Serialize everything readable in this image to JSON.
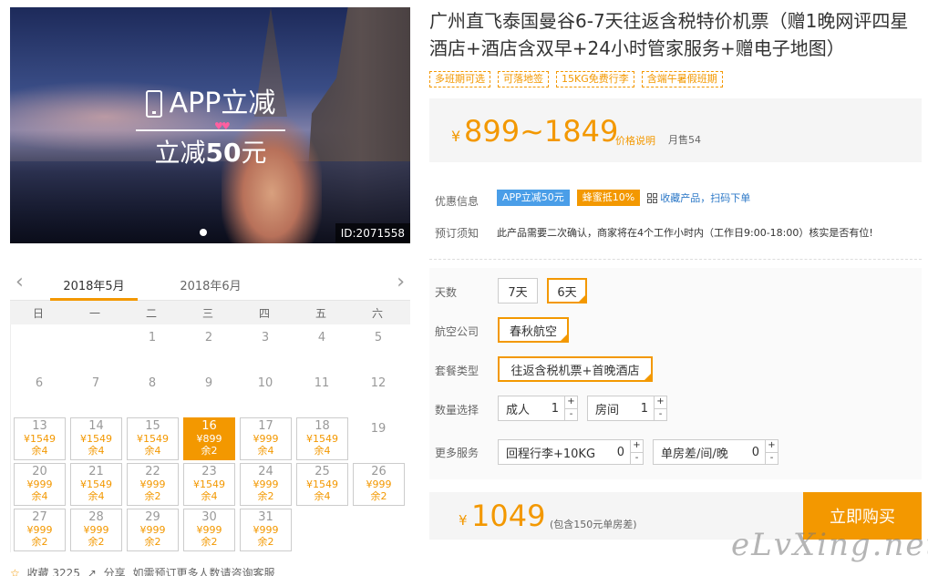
{
  "hero": {
    "promo_top": "APP立减",
    "promo_bottom_prefix": "立减",
    "promo_bottom_amount": "50",
    "promo_bottom_suffix": "元",
    "hearts": "♥♥",
    "id_label": "ID:2071558"
  },
  "calendar": {
    "prev_icon": "‹",
    "next_icon": "›",
    "active_month": "2018年5月",
    "other_month": "2018年6月",
    "weekdays": [
      "日",
      "一",
      "二",
      "三",
      "四",
      "五",
      "六"
    ]
  },
  "footer": {
    "fav_icon": "☆",
    "fav_text": "收藏 3225",
    "share_icon": "↗",
    "share_text": "分享",
    "consult_text": "如需预订更多人数请咨询客服"
  },
  "product": {
    "title": "广州直飞泰国曼谷6-7天往返含税特价机票（赠1晚网评四星酒店+酒店含双早+24小时管家服务+赠电子地图）",
    "tags": [
      "多班期可选",
      "可落地签",
      "15KG免费行李",
      "含端午暑假班期"
    ],
    "price_yen": "¥",
    "price_range": "899~1849",
    "price_explain": "价格说明",
    "sold": "月售54"
  },
  "info": {
    "discount_label": "优惠信息",
    "app_badge": "APP立减50元",
    "bee_badge": "蜂蜜抵10%",
    "qr_text": "收藏产品，扫码下单",
    "notice_label": "预订须知",
    "notice_text": "此产品需要二次确认，商家将在4个工作小时内（工作日9:00-18:00）核实是否有位!"
  },
  "options": {
    "days_label": "天数",
    "days": [
      "7天",
      "6天"
    ],
    "airline_label": "航空公司",
    "airline": "春秋航空",
    "package_label": "套餐类型",
    "package": "往返含税机票+首晚酒店",
    "qty_label": "数量选择",
    "adult_label": "成人",
    "adult_value": "1",
    "room_label": "房间",
    "room_value": "1",
    "more_label": "更多服务",
    "luggage_label": "回程行李+10KG",
    "luggage_value": "0",
    "single_label": "单房差/间/晚",
    "single_value": "0",
    "plus": "+",
    "minus": "-"
  },
  "total": {
    "yen": "¥",
    "amount": "1049",
    "note": "(包含150元单房差)",
    "buy": "立即购买"
  },
  "watermark": "eLvXing.net",
  "colors": {
    "accent": "#f39800",
    "blue": "#4a9ee8",
    "link": "#2c78c7"
  }
}
